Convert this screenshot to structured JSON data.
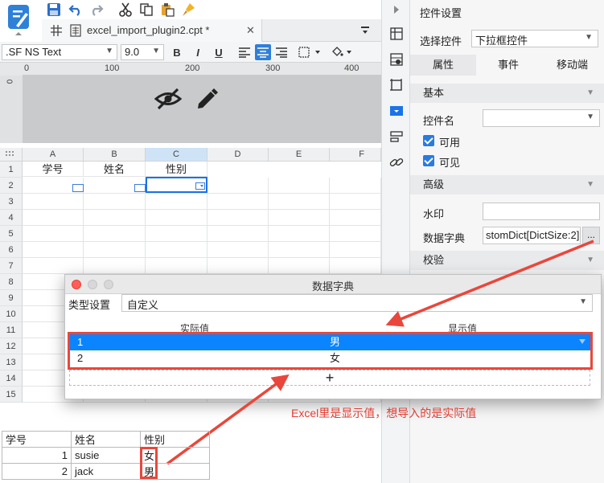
{
  "editor": {
    "tab_title": "excel_import_plugin2.cpt *",
    "tab_close": "✕",
    "font_name": ".SF NS Text",
    "font_size": "9.0",
    "bold": "B",
    "italic": "I",
    "underline": "U",
    "ruler_ticks": [
      "0",
      "100",
      "200",
      "300",
      "400"
    ],
    "ruler_v_zero": "0"
  },
  "grid": {
    "columns": [
      "A",
      "B",
      "C",
      "D",
      "E",
      "F"
    ],
    "rows": [
      "1",
      "2",
      "3",
      "4",
      "5",
      "6",
      "7",
      "8",
      "9",
      "10",
      "11",
      "12",
      "13",
      "14",
      "15"
    ],
    "row1": [
      "学号",
      "姓名",
      "性别"
    ]
  },
  "panel": {
    "title": "控件设置",
    "select_label": "选择控件",
    "select_value": "下拉框控件",
    "tabs": [
      "属性",
      "事件",
      "移动端"
    ],
    "sec_basic": "基本",
    "name_label": "控件名",
    "enabled_label": "可用",
    "visible_label": "可见",
    "sec_advanced": "高级",
    "watermark_label": "水印",
    "dict_label": "数据字典",
    "dict_value": "stomDict[DictSize:2]",
    "dict_btn": "...",
    "sec_validate": "校验"
  },
  "dialog": {
    "title": "数据字典",
    "type_label": "类型设置",
    "type_value": "自定义",
    "col_real": "实际值",
    "col_display": "显示值",
    "rows": [
      {
        "real": "1",
        "display": "男"
      },
      {
        "real": "2",
        "display": "女"
      }
    ],
    "add": "+"
  },
  "annotation": "Excel里是显示值，想导入的是实际值",
  "sample_table": {
    "headers": [
      "学号",
      "姓名",
      "性别"
    ],
    "rows": [
      [
        "1",
        "susie",
        "女"
      ],
      [
        "2",
        "jack",
        "男"
      ]
    ]
  },
  "colors": {
    "accent": "#0a84ff",
    "annotation_red": "#e9473b",
    "selection": "#1a73e8"
  }
}
